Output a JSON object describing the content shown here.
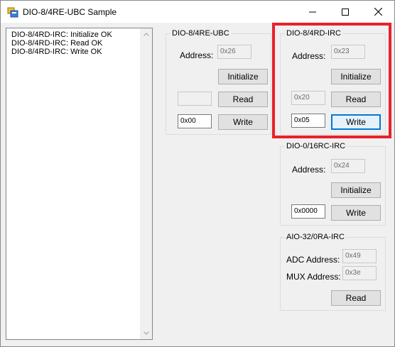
{
  "window": {
    "title": "DIO-8/4RE-UBC Sample"
  },
  "log": {
    "lines": [
      "DIO-8/4RD-IRC: Initialize OK",
      "DIO-8/4RD-IRC: Read OK",
      "DIO-8/4RD-IRC: Write OK"
    ]
  },
  "groups": {
    "dio84re": {
      "title": "DIO-8/4RE-UBC",
      "address_label": "Address:",
      "address": "0x26",
      "initialize": "Initialize",
      "read_value": "",
      "read": "Read",
      "write_value": "0x00",
      "write": "Write"
    },
    "dio84rd": {
      "title": "DIO-8/4RD-IRC",
      "address_label": "Address:",
      "address": "0x23",
      "initialize": "Initialize",
      "read_value": "0x20",
      "read": "Read",
      "write_value": "0x05",
      "write": "Write"
    },
    "dio016rc": {
      "title": "DIO-0/16RC-IRC",
      "address_label": "Address:",
      "address": "0x24",
      "initialize": "Initialize",
      "write_value": "0x0000",
      "write": "Write"
    },
    "aio320ra": {
      "title": "AIO-32/0RA-IRC",
      "adc_label": "ADC Address:",
      "adc_address": "0x49",
      "mux_label": "MUX Address:",
      "mux_address": "0x3e",
      "read": "Read"
    }
  },
  "highlight_color": "#e8212a"
}
